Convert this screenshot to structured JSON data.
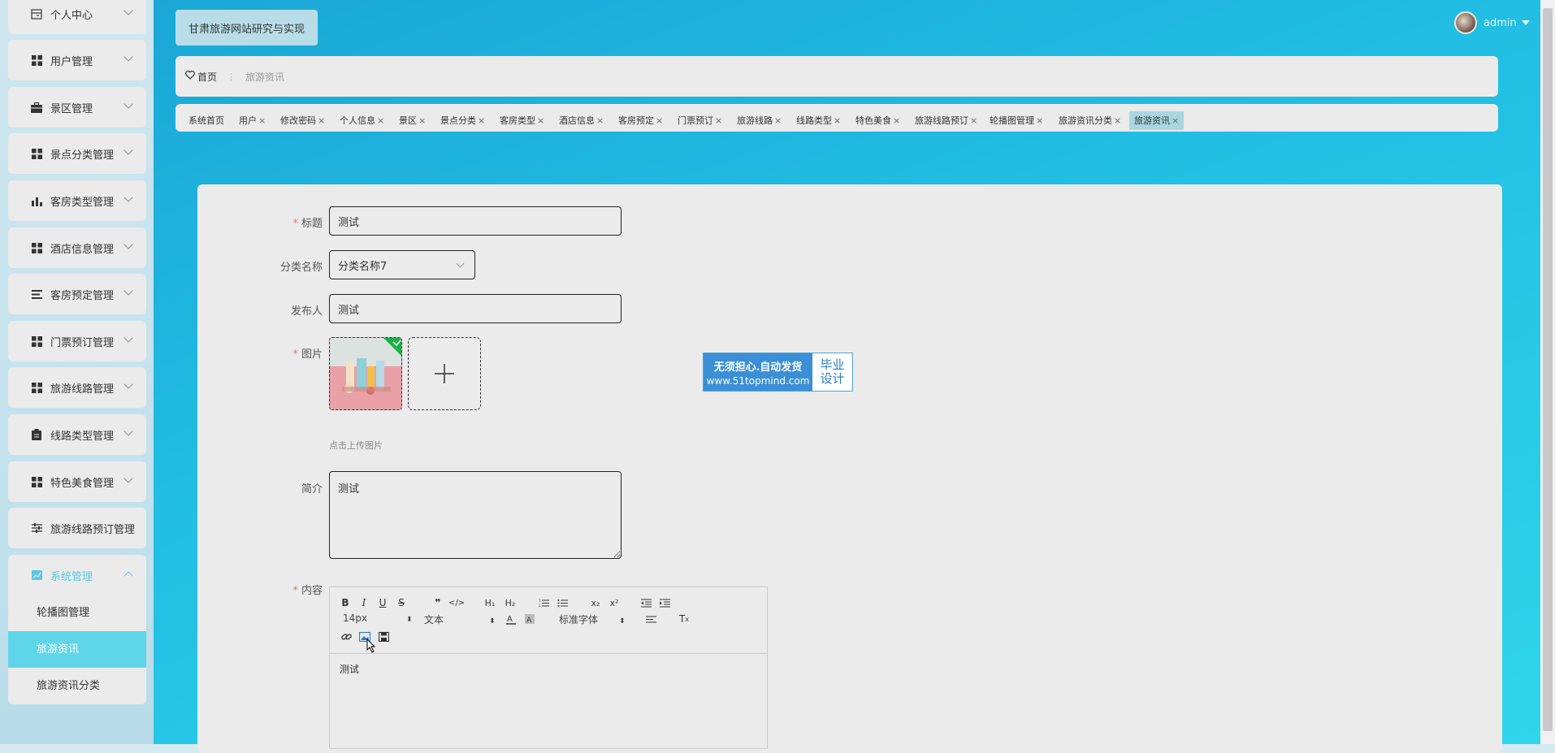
{
  "app": {
    "title": "甘肃旅游网站研究与实现",
    "user": "admin"
  },
  "sidebar": {
    "items": [
      {
        "label": "个人中心",
        "icon": "window-icon"
      },
      {
        "label": "用户管理",
        "icon": "grid-icon"
      },
      {
        "label": "景区管理",
        "icon": "briefcase-icon"
      },
      {
        "label": "景点分类管理",
        "icon": "grid-icon"
      },
      {
        "label": "客房类型管理",
        "icon": "bar-chart-icon"
      },
      {
        "label": "酒店信息管理",
        "icon": "grid-icon"
      },
      {
        "label": "客房预定管理",
        "icon": "list-icon"
      },
      {
        "label": "门票预订管理",
        "icon": "grid-icon"
      },
      {
        "label": "旅游线路管理",
        "icon": "grid-icon"
      },
      {
        "label": "线路类型管理",
        "icon": "clipboard-icon"
      },
      {
        "label": "特色美食管理",
        "icon": "grid-icon"
      },
      {
        "label": "旅游线路预订管理",
        "icon": "sliders-icon"
      },
      {
        "label": "系统管理",
        "icon": "chart-icon"
      }
    ],
    "submenu": [
      {
        "label": "轮播图管理"
      },
      {
        "label": "旅游资讯"
      },
      {
        "label": "旅游资讯分类"
      }
    ]
  },
  "breadcrumb": {
    "home": "首页",
    "current": "旅游资讯"
  },
  "tabs": [
    {
      "label": "系统首页",
      "closable": false
    },
    {
      "label": "用户",
      "closable": true
    },
    {
      "label": "修改密码",
      "closable": true
    },
    {
      "label": "个人信息",
      "closable": true
    },
    {
      "label": "景区",
      "closable": true
    },
    {
      "label": "景点分类",
      "closable": true
    },
    {
      "label": "客房类型",
      "closable": true
    },
    {
      "label": "酒店信息",
      "closable": true
    },
    {
      "label": "客房预定",
      "closable": true
    },
    {
      "label": "门票预订",
      "closable": true
    },
    {
      "label": "旅游线路",
      "closable": true
    },
    {
      "label": "线路类型",
      "closable": true
    },
    {
      "label": "特色美食",
      "closable": true
    },
    {
      "label": "旅游线路预订",
      "closable": true
    },
    {
      "label": "轮播图管理",
      "closable": true
    },
    {
      "label": "旅游资讯分类",
      "closable": true
    },
    {
      "label": "旅游资讯",
      "closable": true,
      "active": true
    }
  ],
  "form": {
    "title": {
      "label": "标题",
      "value": "测试",
      "required": true
    },
    "category": {
      "label": "分类名称",
      "value": "分类名称7"
    },
    "publisher": {
      "label": "发布人",
      "value": "测试"
    },
    "image": {
      "label": "图片",
      "hint": "点击上传图片",
      "required": true
    },
    "intro": {
      "label": "简介",
      "value": "测试"
    },
    "content": {
      "label": "内容",
      "value": "测试",
      "required": true
    }
  },
  "editor_toolbar": {
    "font_size": "14px",
    "header_picker": "文本",
    "font_family": "标准字体"
  },
  "watermark": {
    "line1": "无须担心.自动发货",
    "line2": "www.51topmind.com",
    "right1": "毕业",
    "right2": "设计"
  },
  "colors": {
    "accent": "#5ed5e8",
    "required": "#f56c6c",
    "header_gradient_start": "#1aa7d6",
    "header_gradient_end": "#2fd6ea"
  }
}
